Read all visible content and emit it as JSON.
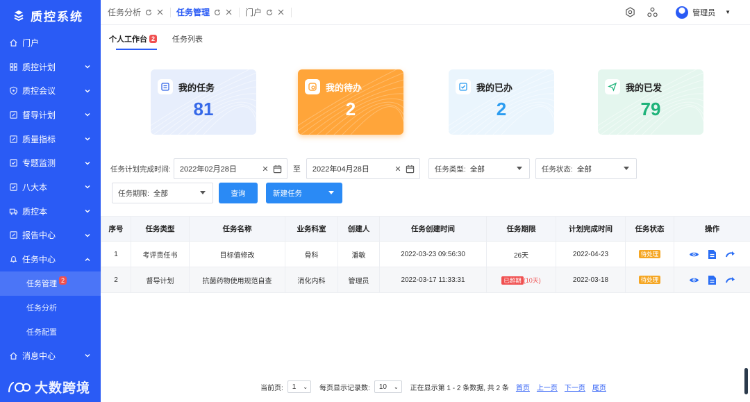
{
  "app": {
    "title": "质控系统",
    "watermark": "大数跨境"
  },
  "sidebar": {
    "items": [
      {
        "label": "门户",
        "icon": "home-icon",
        "has_children": false
      },
      {
        "label": "质控计划",
        "icon": "grid-icon",
        "has_children": true
      },
      {
        "label": "质控会议",
        "icon": "shield-icon",
        "has_children": true
      },
      {
        "label": "督导计划",
        "icon": "edit-icon",
        "has_children": true
      },
      {
        "label": "质量指标",
        "icon": "edit-icon",
        "has_children": true
      },
      {
        "label": "专题监测",
        "icon": "check-square-icon",
        "has_children": true
      },
      {
        "label": "八大本",
        "icon": "check-square-icon",
        "has_children": true
      },
      {
        "label": "质控本",
        "icon": "truck-icon",
        "has_children": true
      },
      {
        "label": "报告中心",
        "icon": "edit-icon",
        "has_children": true
      },
      {
        "label": "任务中心",
        "icon": "bell-icon",
        "has_children": true,
        "expanded": true
      }
    ],
    "task_children": [
      {
        "label": "任务管理",
        "badge": "2",
        "active": true
      },
      {
        "label": "任务分析"
      },
      {
        "label": "任务配置"
      }
    ],
    "after": {
      "label": "消息中心",
      "icon": "globe-icon"
    }
  },
  "topbar": {
    "tabs": [
      {
        "label": "任务分析",
        "active": false
      },
      {
        "label": "任务管理",
        "active": true
      },
      {
        "label": "门户",
        "active": false
      }
    ],
    "user": "管理员"
  },
  "subtabs": [
    {
      "label": "个人工作台",
      "badge": "2",
      "active": true
    },
    {
      "label": "任务列表",
      "active": false
    }
  ],
  "cards": [
    {
      "title": "我的任务",
      "value": "81",
      "color": "#3568e8",
      "bg": "#e7eefc"
    },
    {
      "title": "我的待办",
      "value": "2",
      "color": "#ffffff",
      "bg": "#ffa53a"
    },
    {
      "title": "我的已办",
      "value": "2",
      "color": "#2b9cf0",
      "bg": "#eaf5fd"
    },
    {
      "title": "我的已发",
      "value": "79",
      "color": "#1fb37a",
      "bg": "#e4f6ee"
    }
  ],
  "filters": {
    "date_label": "任务计划完成时间:",
    "start_date": "2022年02月28日",
    "to": "至",
    "end_date": "2022年04月28日",
    "type_label": "任务类型:",
    "type_value": "全部",
    "status_label": "任务状态:",
    "status_value": "全部",
    "period_label": "任务期限:",
    "period_value": "全部",
    "query_btn": "查询",
    "new_btn": "新建任务"
  },
  "table": {
    "headers": [
      "序号",
      "任务类型",
      "任务名称",
      "业务科室",
      "创建人",
      "任务创建时间",
      "任务期限",
      "计划完成时间",
      "任务状态",
      "操作"
    ],
    "rows": [
      {
        "no": "1",
        "type": "考评责任书",
        "name": "目标值修改",
        "dept": "骨科",
        "creator": "潘敏",
        "created": "2022-03-23 09:56:30",
        "period": "26天",
        "overdue": "",
        "planned": "2022-04-23",
        "status": "待处理"
      },
      {
        "no": "2",
        "type": "督导计划",
        "name": "抗菌药物使用规范自查",
        "dept": "消化内科",
        "creator": "管理员",
        "created": "2022-03-17 11:33:31",
        "period": "(10天)",
        "overdue": "已超期",
        "planned": "2022-03-18",
        "status": "待处理"
      }
    ]
  },
  "pager": {
    "current_label": "当前页:",
    "current": "1",
    "size_label": "每页显示记录数:",
    "size": "10",
    "summary": "正在显示第 1 - 2 条数据, 共 2 条",
    "first": "首页",
    "prev": "上一页",
    "next": "下一页",
    "last": "尾页"
  }
}
